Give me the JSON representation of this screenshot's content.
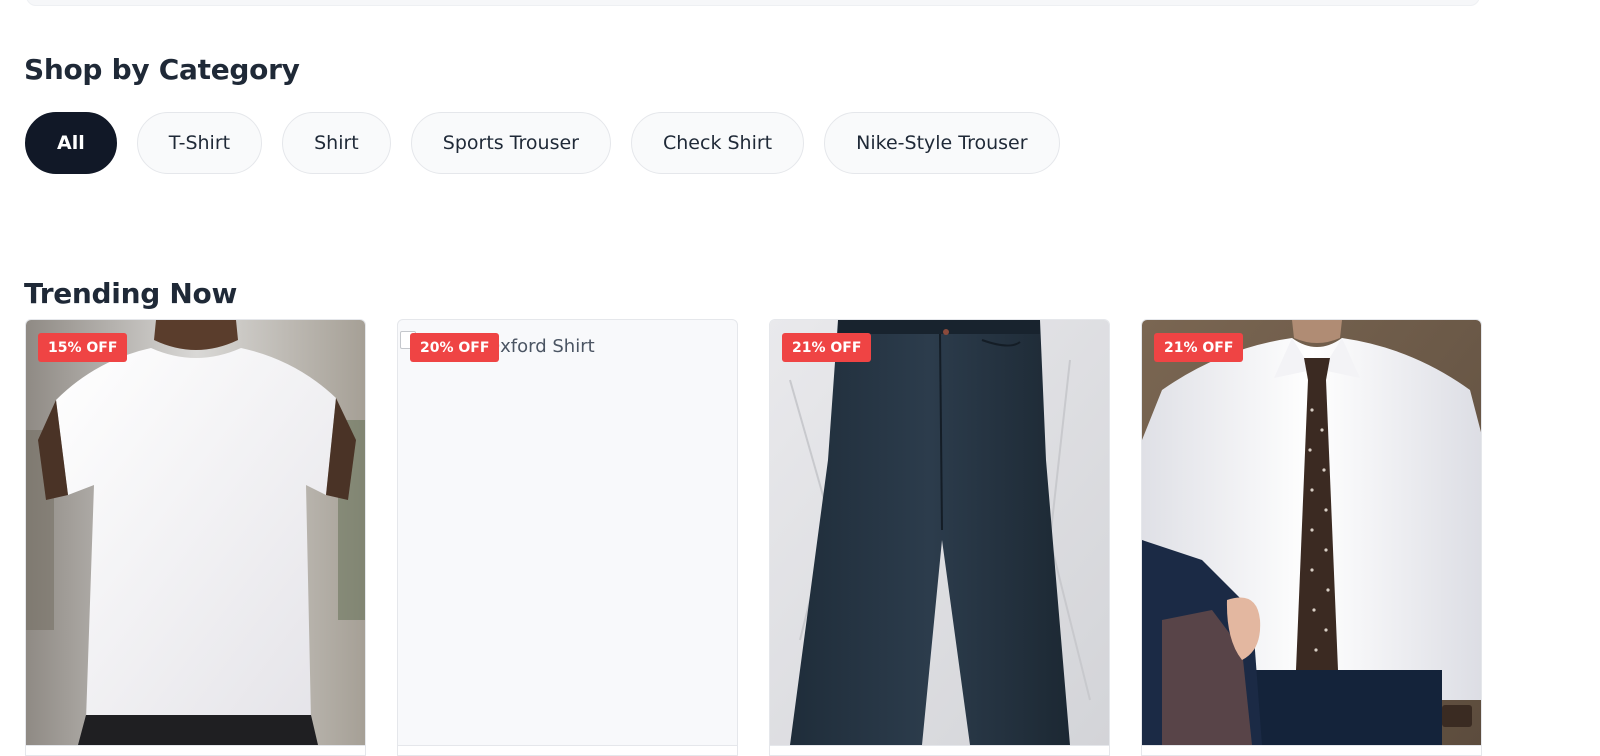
{
  "shop_section": {
    "title": "Shop by Category",
    "categories": [
      {
        "label": "All",
        "active": true
      },
      {
        "label": "T-Shirt",
        "active": false
      },
      {
        "label": "Shirt",
        "active": false
      },
      {
        "label": "Sports Trouser",
        "active": false
      },
      {
        "label": "Check Shirt",
        "active": false
      },
      {
        "label": "Nike-Style Trouser",
        "active": false
      }
    ]
  },
  "trending_section": {
    "title": "Trending Now",
    "products": [
      {
        "discount": "15% OFF",
        "image": "white-tshirt-photo"
      },
      {
        "discount": "20% OFF",
        "image_alt": "Classic Oxford Shirt",
        "image_broken": true
      },
      {
        "discount": "21% OFF",
        "image": "dark-jeans-photo"
      },
      {
        "discount": "21% OFF",
        "image": "white-dress-shirt-tie-photo"
      }
    ]
  },
  "colors": {
    "active_chip": "#111827",
    "discount_badge": "#ef4444"
  }
}
